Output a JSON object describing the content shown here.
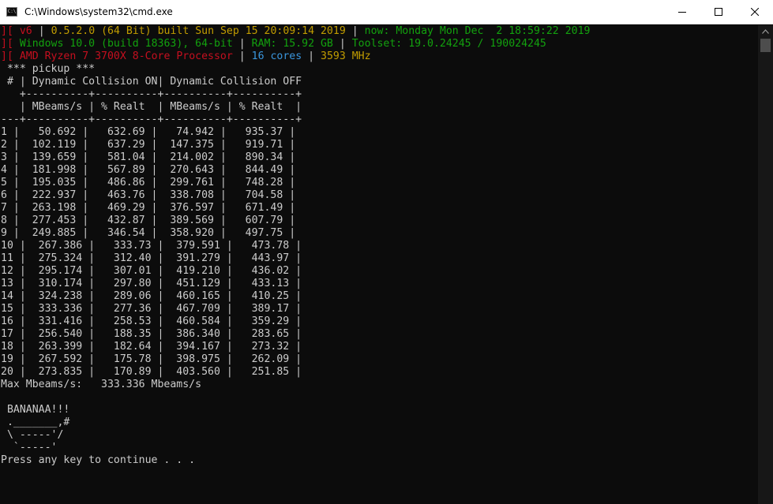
{
  "window": {
    "title": "C:\\Windows\\system32\\cmd.exe",
    "icon_text": "C:\\",
    "icon": "cmd-app-icon",
    "controls": [
      "minimize-icon",
      "maximize-icon",
      "close-icon"
    ]
  },
  "colors": {
    "background": "#0c0c0c",
    "text": "#cccccc",
    "red": "#c50f1f",
    "green": "#13a10e",
    "blue": "#3a96dd",
    "yellow": "#c19c00"
  },
  "header": {
    "line1": {
      "bracket": "][",
      "version": "v6",
      "sep1": "|",
      "build": "0.5.2.0 (64 Bit) built Sun Sep 15 20:09:14 2019",
      "sep2": "|",
      "now": "now: Monday Mon Dec  2 18:59:22 2019"
    },
    "line2": {
      "bracket": "][",
      "os": "Windows 10.0 (build 18363), 64-bit",
      "sep1": "|",
      "ram": "RAM: 15.92 GB",
      "sep2": "|",
      "toolset": "Toolset: 19.0.24245 / 190024245"
    },
    "line3": {
      "bracket": "][",
      "cpu": "AMD Ryzen 7 3700X 8-Core Processor",
      "sep1": "|",
      "cores": "16 cores",
      "sep2": "|",
      "mhz": "3593 MHz"
    }
  },
  "table": {
    "title_line": " *** pickup ***",
    "group_header": " # | Dynamic Collision ON| Dynamic Collision OFF",
    "border_top": "   +----------+----------+----------+----------+",
    "col_header": "   | MBeams/s | % Realt  | MBeams/s | % Realt  |",
    "border_mid": "---+----------+----------+----------+----------+",
    "rows": [
      "1 |   50.692 |   632.69 |   74.942 |   935.37 |",
      "2 |  102.119 |   637.29 |  147.375 |   919.71 |",
      "3 |  139.659 |   581.04 |  214.002 |   890.34 |",
      "4 |  181.998 |   567.89 |  270.643 |   844.49 |",
      "5 |  195.035 |   486.86 |  299.761 |   748.28 |",
      "6 |  222.937 |   463.76 |  338.708 |   704.58 |",
      "7 |  263.198 |   469.29 |  376.597 |   671.49 |",
      "8 |  277.453 |   432.87 |  389.569 |   607.79 |",
      "9 |  249.885 |   346.54 |  358.920 |   497.75 |",
      "10 |  267.386 |   333.73 |  379.591 |   473.78 |",
      "11 |  275.324 |   312.40 |  391.279 |   443.97 |",
      "12 |  295.174 |   307.01 |  419.210 |   436.02 |",
      "13 |  310.174 |   297.80 |  451.129 |   433.13 |",
      "14 |  324.238 |   289.06 |  460.165 |   410.25 |",
      "15 |  333.336 |   277.36 |  467.709 |   389.17 |",
      "16 |  331.416 |   258.53 |  460.584 |   359.29 |",
      "17 |  256.540 |   188.35 |  386.340 |   283.65 |",
      "18 |  263.399 |   182.64 |  394.167 |   273.32 |",
      "19 |  267.592 |   175.78 |  398.975 |   262.09 |",
      "20 |  273.835 |   170.89 |  403.560 |   251.85 |"
    ]
  },
  "summary": {
    "max_line": "Max Mbeams/s:   333.336 Mbeams/s"
  },
  "art": [
    " BANANAA!!!",
    " ._______,#",
    " \\ -----'/",
    "  `-----'"
  ],
  "prompt": {
    "text": "Press any key to continue . . ."
  }
}
